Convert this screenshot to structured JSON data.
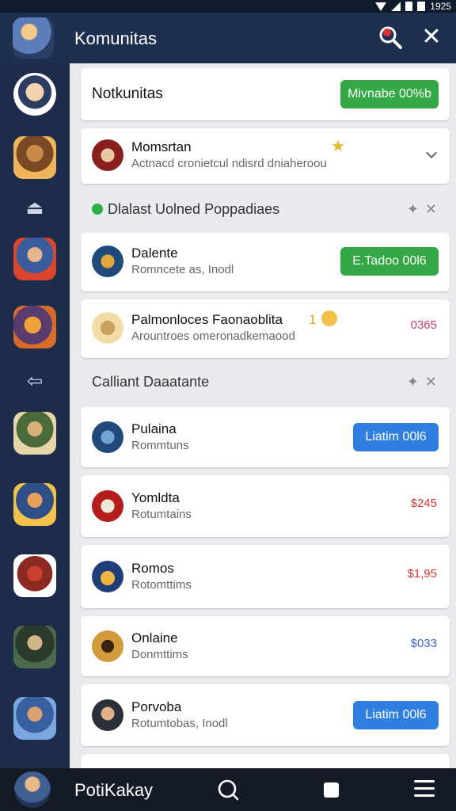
{
  "status_bar": {
    "time": "1925"
  },
  "app_bar": {
    "title": "Komunitas"
  },
  "header_card": {
    "title": "Notkunitas",
    "button": "Mivnabe 00%b"
  },
  "featured": {
    "title": "Momsrtan",
    "subtitle": "Actnacd cronietcul ndisrd dniaheroou"
  },
  "section_1": {
    "label": "Dlalast Uolned Poppadiaes"
  },
  "items_1": [
    {
      "title": "Dalente",
      "subtitle": "Romncete as, Inodl",
      "button": "E.Tadoo 00l6"
    },
    {
      "title": "Palmonloces Faonaoblita",
      "badge": "1",
      "subtitle": "Arountroes omeronadkemaood",
      "price": "0365"
    }
  ],
  "section_2": {
    "label": "Calliant Daaatante"
  },
  "items_2": [
    {
      "title": "Pulaina",
      "subtitle": "Rommtuns",
      "button": "Liatim 00l6"
    },
    {
      "title": "Yomldta",
      "subtitle": "Rotumtains",
      "price": "$245"
    },
    {
      "title": "Romos",
      "subtitle": "Rotomttims",
      "price": "$1,95"
    },
    {
      "title": "Onlaine",
      "subtitle": "Donmttims",
      "price": "$033"
    },
    {
      "title": "Porvoba",
      "subtitle": "Rotumtobas, Inodl",
      "button": "Liatim 00l6"
    }
  ],
  "bottom_bar": {
    "name": "PotiKakay"
  },
  "colors": {
    "green_button": "#34a845",
    "blue_button": "#2f7fe0",
    "price_magenta": "#c0407a",
    "price_red": "#d33a3a",
    "price_blue": "#3f6ac9",
    "sidebar": "#1c2c4a"
  }
}
